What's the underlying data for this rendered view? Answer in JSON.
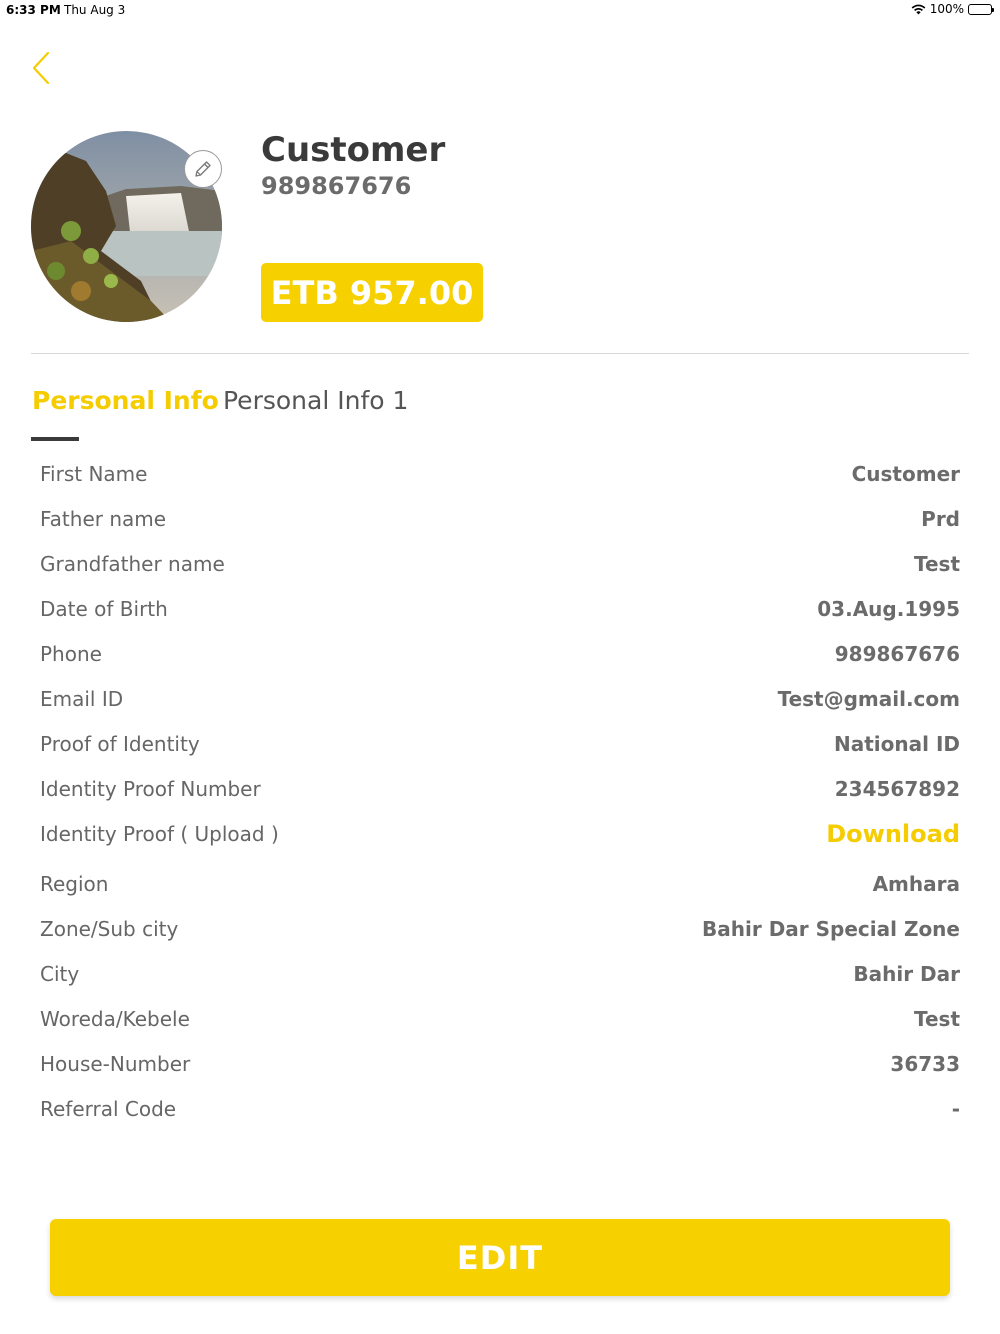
{
  "status_bar": {
    "time": "6:33 PM",
    "date": "Thu Aug 3",
    "battery": "100%"
  },
  "colors": {
    "accent": "#f7d000",
    "text_dark": "#3a3a3a",
    "text_muted": "#666666"
  },
  "header": {
    "back_icon": "chevron-left-icon"
  },
  "profile": {
    "name": "Customer",
    "phone": "989867676",
    "balance": "ETB 957.00",
    "edit_photo_icon": "pencil-icon"
  },
  "tabs": [
    {
      "label": "Personal Info",
      "active": true
    },
    {
      "label": "Personal Info 1",
      "active": false
    }
  ],
  "info_rows": [
    {
      "label": "First Name",
      "value": "Customer"
    },
    {
      "label": "Father name",
      "value": "Prd"
    },
    {
      "label": "Grandfather name",
      "value": "Test"
    },
    {
      "label": "Date of Birth",
      "value": "03.Aug.1995"
    },
    {
      "label": "Phone",
      "value": "989867676"
    },
    {
      "label": "Email ID",
      "value": "Test@gmail.com"
    },
    {
      "label": "Proof of Identity",
      "value": "National ID"
    },
    {
      "label": "Identity Proof Number",
      "value": "234567892"
    },
    {
      "label": "Identity Proof ( Upload )",
      "value": "Download"
    },
    {
      "label": "Region",
      "value": "Amhara"
    },
    {
      "label": "Zone/Sub city",
      "value": "Bahir Dar Special Zone"
    },
    {
      "label": "City",
      "value": "Bahir Dar"
    },
    {
      "label": "Woreda/Kebele",
      "value": "Test"
    },
    {
      "label": "House-Number",
      "value": "36733"
    },
    {
      "label": "Referral Code",
      "value": "-"
    }
  ],
  "actions": {
    "edit_label": "EDIT"
  }
}
